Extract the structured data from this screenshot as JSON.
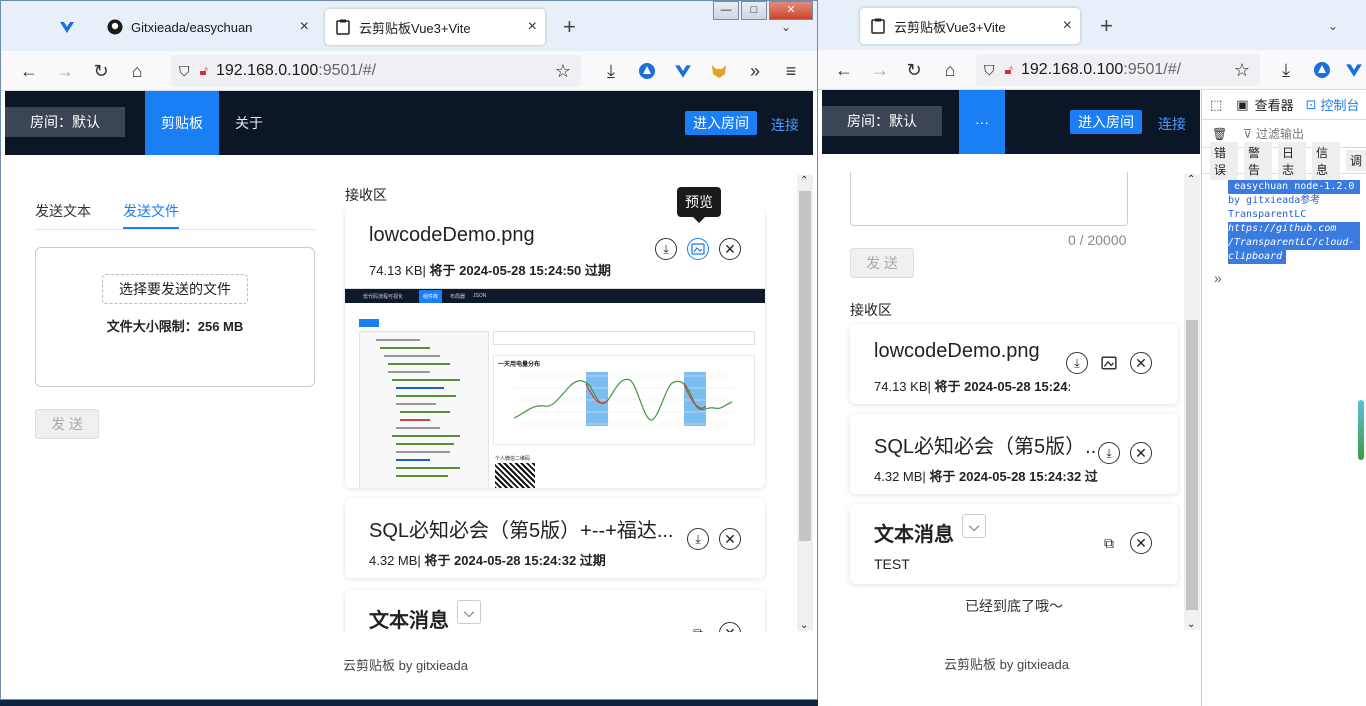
{
  "left_window": {
    "tabs": [
      {
        "label": ""
      },
      {
        "label": "Gitxieada/easychuan"
      },
      {
        "label": "云剪贴板Vue3+Vite"
      }
    ],
    "url_host": "192.168.0.100",
    "url_rest": ":9501/#/",
    "window_controls": {
      "minimize": "—",
      "maximize": "□",
      "close": "✕"
    }
  },
  "right_window": {
    "tab_label": "云剪贴板Vue3+Vite",
    "url_host": "192.168.0.100",
    "url_rest": ":9501/#/"
  },
  "app": {
    "room_label": "房间：默认",
    "nav_clipboard": "剪贴板",
    "nav_about": "关于",
    "nav_more": "···",
    "enter_room": "进入房间",
    "connect": "连接",
    "send_tab_text": "发送文本",
    "send_tab_file": "发送文件",
    "choose_file": "选择要发送的文件",
    "file_limit": "文件大小限制：256 MB",
    "send_button": "发 送",
    "receive_title": "接收区",
    "tooltip_preview": "预览",
    "char_count": "0 / 20000",
    "bottom_msg": "已经到底了哦～",
    "footer": "云剪贴板 by gitxieada",
    "items": [
      {
        "name": "lowcodeDemo.png",
        "size": "74.13 KB|",
        "expire": "将于 2024-05-28 15:24:50 过期"
      },
      {
        "name": "SQL必知必会（第5版）+--+福达...",
        "name_short": "SQL必知必会（第5版）...",
        "size": "4.32 MB|",
        "expire": "将于 2024-05-28 15:24:32 过期"
      },
      {
        "name": "文本消息",
        "content": "TEST"
      }
    ]
  },
  "preview_image": {
    "app_title": "低代码流程可视化",
    "tabs": [
      "组件库",
      "布局器",
      "JSON"
    ],
    "chart_title": "一天用电量分布",
    "qr_label": "个人微信二维码"
  },
  "devtools": {
    "tabs": [
      "查看器",
      "控制台"
    ],
    "filter_placeholder": "过滤输出",
    "levels": [
      "错误",
      "警告",
      "日志",
      "信息",
      "调"
    ],
    "console_lines": [
      "easychuan node-1.2.0",
      "by gitxieada参考",
      "TransparentLC",
      "https://github.com",
      "/TransparentLC/cloud-",
      "clipboard"
    ]
  }
}
